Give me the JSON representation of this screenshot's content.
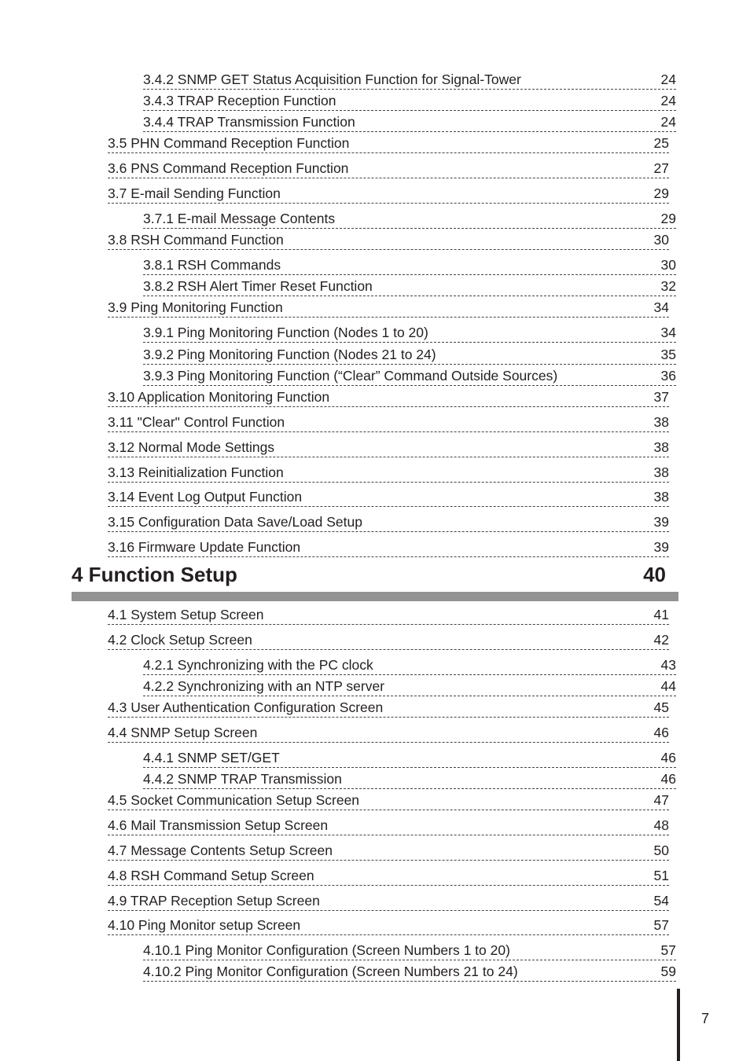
{
  "entries_before": [
    {
      "level": 3,
      "title": "3.4.2 SNMP GET Status Acquisition Function for Signal-Tower",
      "page": "24"
    },
    {
      "level": 3,
      "title": "3.4.3 TRAP Reception Function",
      "page": "24"
    },
    {
      "level": 3,
      "title": "3.4.4 TRAP Transmission Function",
      "page": "24"
    },
    {
      "level": 2,
      "title": "3.5 PHN Command Reception Function",
      "page": "25"
    },
    {
      "level": 2,
      "title": "3.6 PNS Command Reception Function",
      "page": "27"
    },
    {
      "level": 2,
      "title": "3.7 E-mail Sending Function",
      "page": "29"
    },
    {
      "level": 3,
      "title": "3.7.1 E-mail Message Contents",
      "page": "29"
    },
    {
      "level": 2,
      "title": "3.8 RSH Command Function",
      "page": "30"
    },
    {
      "level": 3,
      "title": "3.8.1 RSH Commands",
      "page": "30"
    },
    {
      "level": 3,
      "title": "3.8.2 RSH Alert Timer Reset Function",
      "page": "32"
    },
    {
      "level": 2,
      "title": "3.9 Ping Monitoring Function",
      "page": "34"
    },
    {
      "level": 3,
      "title": "3.9.1 Ping Monitoring Function (Nodes 1 to 20)",
      "page": "34"
    },
    {
      "level": 3,
      "title": "3.9.2 Ping Monitoring Function (Nodes 21 to 24)",
      "page": "35"
    },
    {
      "level": 3,
      "title": "3.9.3 Ping Monitoring Function (“Clear” Command Outside Sources)",
      "page": "36"
    },
    {
      "level": 2,
      "title": "3.10 Application Monitoring Function",
      "page": "37"
    },
    {
      "level": 2,
      "title": "3.11 \"Clear\" Control Function",
      "page": "38"
    },
    {
      "level": 2,
      "title": "3.12 Normal Mode Settings",
      "page": "38"
    },
    {
      "level": 2,
      "title": "3.13 Reinitialization Function",
      "page": "38"
    },
    {
      "level": 2,
      "title": "3.14 Event Log Output Function",
      "page": "38"
    },
    {
      "level": 2,
      "title": "3.15 Configuration Data Save/Load Setup",
      "page": "39"
    },
    {
      "level": 2,
      "title": "3.16 Firmware Update Function",
      "page": "39"
    }
  ],
  "chapter": {
    "title": "4 Function Setup",
    "page": "40"
  },
  "entries_after": [
    {
      "level": 2,
      "title": "4.1 System Setup Screen",
      "page": "41"
    },
    {
      "level": 2,
      "title": "4.2 Clock Setup Screen",
      "page": "42"
    },
    {
      "level": 3,
      "title": "4.2.1 Synchronizing with the PC clock",
      "page": "43"
    },
    {
      "level": 3,
      "title": "4.2.2 Synchronizing with an NTP server",
      "page": "44"
    },
    {
      "level": 2,
      "title": "4.3 User Authentication Configuration Screen",
      "page": "45"
    },
    {
      "level": 2,
      "title": "4.4 SNMP Setup Screen",
      "page": "46"
    },
    {
      "level": 3,
      "title": "4.4.1 SNMP SET/GET",
      "page": "46"
    },
    {
      "level": 3,
      "title": "4.4.2 SNMP TRAP Transmission",
      "page": "46"
    },
    {
      "level": 2,
      "title": "4.5 Socket Communication Setup Screen",
      "page": "47"
    },
    {
      "level": 2,
      "title": "4.6 Mail Transmission Setup Screen",
      "page": "48"
    },
    {
      "level": 2,
      "title": "4.7 Message Contents Setup Screen",
      "page": "50"
    },
    {
      "level": 2,
      "title": "4.8 RSH Command Setup Screen",
      "page": "51"
    },
    {
      "level": 2,
      "title": "4.9 TRAP Reception Setup Screen",
      "page": "54"
    },
    {
      "level": 2,
      "title": "4.10 Ping Monitor setup Screen",
      "page": "57"
    },
    {
      "level": 3,
      "title": "4.10.1 Ping Monitor Configuration (Screen Numbers 1 to 20)",
      "page": "57"
    },
    {
      "level": 3,
      "title": "4.10.2 Ping Monitor Configuration (Screen Numbers 21 to 24)",
      "page": "59"
    }
  ],
  "page_number": "7"
}
